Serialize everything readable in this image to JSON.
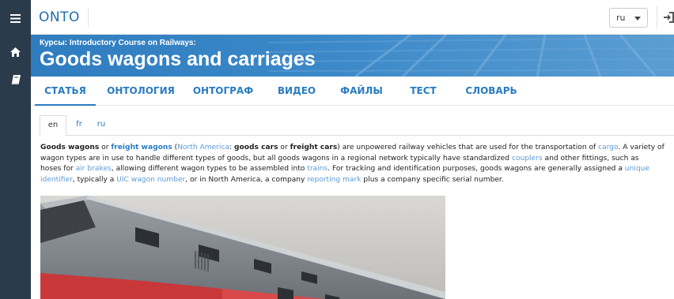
{
  "sidebar": {
    "items": [
      {
        "icon": "menu-icon"
      },
      {
        "icon": "home-icon"
      },
      {
        "icon": "book-icon"
      }
    ]
  },
  "header": {
    "logo_text": "ONTO",
    "language": "ru"
  },
  "banner": {
    "breadcrumb": "Курсы: Introductory Course on Railways:",
    "title": "Goods wagons and carriages"
  },
  "tabs": [
    {
      "label": "СТАТЬЯ",
      "active": true
    },
    {
      "label": "ОНТОЛОГИЯ"
    },
    {
      "label": "ОНТОГРАФ"
    },
    {
      "label": "ВИДЕО"
    },
    {
      "label": "ФАЙЛЫ"
    },
    {
      "label": "ТЕСТ"
    },
    {
      "label": "СЛОВАРЬ"
    }
  ],
  "language_tabs": [
    {
      "label": "en",
      "active": true
    },
    {
      "label": "fr"
    },
    {
      "label": "ru"
    }
  ],
  "article": {
    "l1": {
      "b1": "Goods wagons",
      "t1": " or ",
      "a1": "freight wagons",
      "t2": " (",
      "a2": "North America",
      "t3": ": ",
      "b2": "goods cars",
      "t4": " or ",
      "b3": "freight cars",
      "t5": ") are unpowered railway vehicles that are used for the transportation of ",
      "a3": "cargo",
      "t6": ". A variety of"
    },
    "l2": {
      "t1": "wagon types are in use to handle different types of goods, but all goods wagons in a regional network typically have standardized ",
      "a1": "couplers",
      "t2": " and other fittings, such as"
    },
    "l3": {
      "t1": "hoses for ",
      "a1": "air brakes",
      "t2": ", allowing different wagon types to be assembled into ",
      "a2": "trains",
      "t3": ". For tracking and identification purposes, goods wagons are generally assigned a ",
      "a3": "unique"
    },
    "l4": {
      "a1": "identifier",
      "t1": ", typically a ",
      "a2": "UIC wagon number",
      "t2": ", or in North America, a company ",
      "a3": "reporting mark",
      "t3": " plus a company specific serial number."
    }
  },
  "colors": {
    "sidebar": "#2b3b4b",
    "banner": "#2e7bbd",
    "link": "#2a7cc2",
    "text": "#222222"
  }
}
